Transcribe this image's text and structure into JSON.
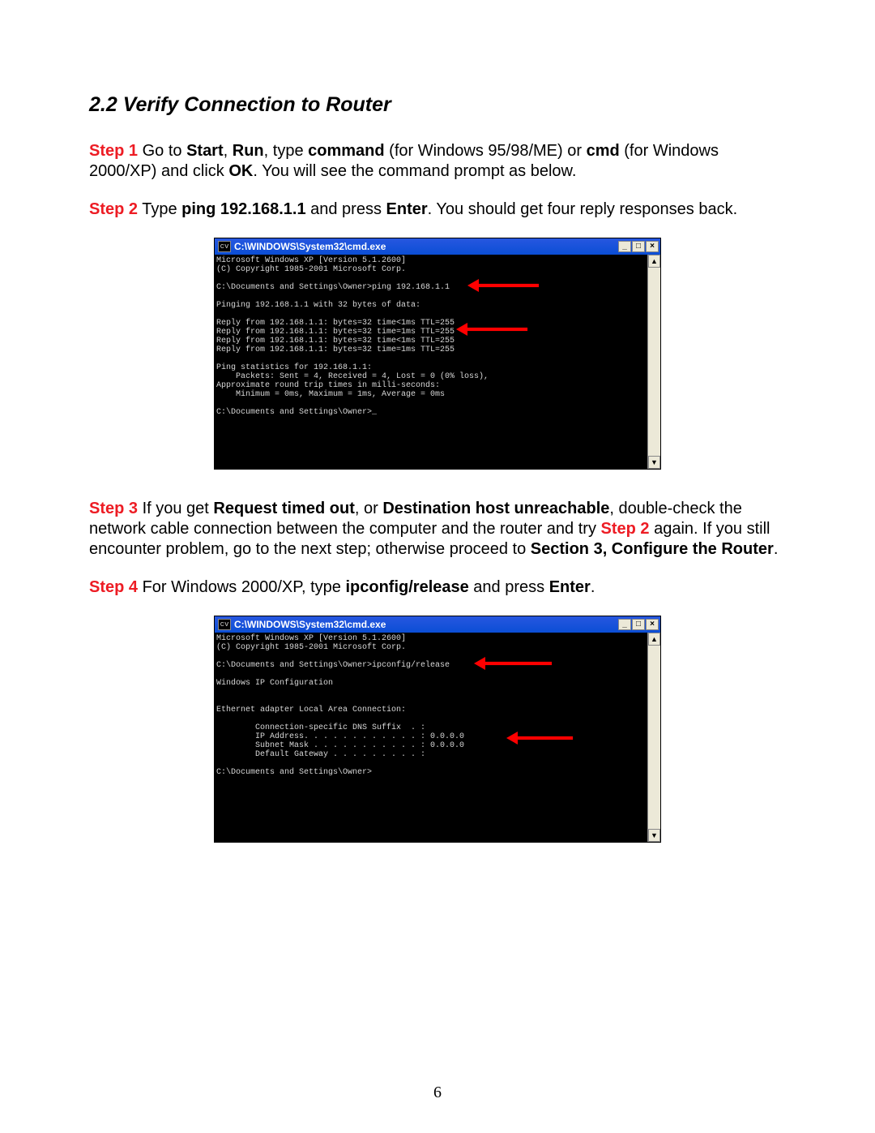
{
  "heading": "2.2 Verify Connection to Router",
  "steps": {
    "s1": {
      "label": "Step 1",
      "t1": " Go to ",
      "b1": "Start",
      "t2": ", ",
      "b2": "Run",
      "t3": ", type ",
      "b3": "command",
      "t4": " (for Windows 95/98/ME) or ",
      "b4": "cmd",
      "t5": " (for Windows 2000/XP) and click ",
      "b5": "OK",
      "t6": ". You will see the command prompt as below."
    },
    "s2": {
      "label": "Step 2",
      "t1": " Type ",
      "b1": "ping 192.168.1.1",
      "t2": " and press ",
      "b2": "Enter",
      "t3": ". You should get four reply responses back."
    },
    "s3": {
      "label": "Step 3",
      "t1": " If you get ",
      "b1": "Request timed out",
      "t2": ", or ",
      "b2": "Destination host unreachable",
      "t3": ", double-check the network cable connection between the computer and the router and try ",
      "rlabel": "Step 2",
      "t4": " again. If you still encounter problem, go to the next step; otherwise proceed to ",
      "b3": "Section 3, Configure the Router",
      "t5": "."
    },
    "s4": {
      "label": "Step 4",
      "t1": " For Windows 2000/XP, type ",
      "b1": "ipconfig/release",
      "t2": " and press ",
      "b2": "Enter",
      "t3": "."
    }
  },
  "cmd_window": {
    "icon_text": "cv",
    "title": "C:\\WINDOWS\\System32\\cmd.exe",
    "min_symbol": "_",
    "max_symbol": "□",
    "close_symbol": "×",
    "scroll_up": "▲",
    "scroll_down": "▼"
  },
  "terminal1": "Microsoft Windows XP [Version 5.1.2600]\n(C) Copyright 1985-2001 Microsoft Corp.\n\nC:\\Documents and Settings\\Owner>ping 192.168.1.1\n\nPinging 192.168.1.1 with 32 bytes of data:\n\nReply from 192.168.1.1: bytes=32 time<1ms TTL=255\nReply from 192.168.1.1: bytes=32 time=1ms TTL=255\nReply from 192.168.1.1: bytes=32 time<1ms TTL=255\nReply from 192.168.1.1: bytes=32 time=1ms TTL=255\n\nPing statistics for 192.168.1.1:\n    Packets: Sent = 4, Received = 4, Lost = 0 (0% loss),\nApproximate round trip times in milli-seconds:\n    Minimum = 0ms, Maximum = 1ms, Average = 0ms\n\nC:\\Documents and Settings\\Owner>_",
  "terminal2": "Microsoft Windows XP [Version 5.1.2600]\n(C) Copyright 1985-2001 Microsoft Corp.\n\nC:\\Documents and Settings\\Owner>ipconfig/release\n\nWindows IP Configuration\n\n\nEthernet adapter Local Area Connection:\n\n        Connection-specific DNS Suffix  . :\n        IP Address. . . . . . . . . . . . : 0.0.0.0\n        Subnet Mask . . . . . . . . . . . : 0.0.0.0\n        Default Gateway . . . . . . . . . :\n\nC:\\Documents and Settings\\Owner>",
  "page_number": "6"
}
